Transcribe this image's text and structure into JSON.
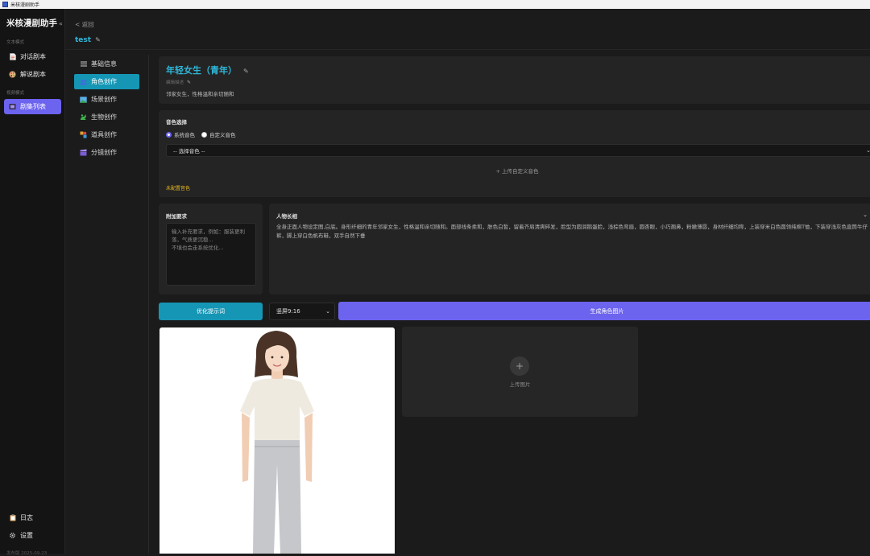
{
  "window": {
    "title": "米核漫剧助手"
  },
  "sidebar": {
    "brand": "米核漫剧助手",
    "collapse_glyph": "«",
    "section_text": "文本模式",
    "section_video": "视频模式",
    "items": [
      {
        "label": "对话剧本",
        "icon": "document-icon"
      },
      {
        "label": "解说剧本",
        "icon": "palette-icon"
      },
      {
        "label": "剧集列表",
        "icon": "film-icon",
        "active": true
      }
    ],
    "bottom": [
      {
        "label": "日志",
        "icon": "clipboard-icon"
      },
      {
        "label": "设置",
        "icon": "gear-icon"
      }
    ],
    "version": "发布版 2025-09-23"
  },
  "header": {
    "back_label": "< 返回",
    "project_title": "test"
  },
  "subnav": {
    "items": [
      {
        "label": "基础信息",
        "icon": "menu-icon"
      },
      {
        "label": "角色创作",
        "icon": "people-icon",
        "active": true
      },
      {
        "label": "场景创作",
        "icon": "landscape-icon"
      },
      {
        "label": "生物创作",
        "icon": "creature-icon"
      },
      {
        "label": "道具创作",
        "icon": "props-icon"
      },
      {
        "label": "分镜创作",
        "icon": "clapper-icon"
      }
    ]
  },
  "character": {
    "name": "年轻女生（青年）",
    "sub_label": "编辑描述",
    "description": "邻家女生，性格温和亲切随和"
  },
  "voice": {
    "title": "音色选择",
    "option_system": "系统音色",
    "option_custom": "自定义音色",
    "selected": "system",
    "select_value": "-- 选择音色 --",
    "upload_label": "+ 上传自定义音色",
    "warning": "未配置音色"
  },
  "extra": {
    "title": "附加要求",
    "placeholder": "输入补充要求，例如：服装更利落，气质更沉稳...\n不填也会走系统优化..."
  },
  "looks": {
    "title": "人物长相",
    "text": "全身正面人物设定图,白底。身形纤细的青年邻家女生，性格温和亲切随和。面部线条柔和，肤色白皙，留着齐肩清爽碎发，脸型为圆润鹅蛋脸，浅棕色弯眉，圆杏眼，小巧翘鼻，粉嫩薄唇，身材纤细均称，上装穿米白色圆领纯棉T恤，下装穿浅灰色直筒牛仔裤，脚上穿白色帆布鞋，双手自然下垂"
  },
  "actions": {
    "optimize_label": "优化提示词",
    "ratio_value": "竖屏9:16",
    "generate_label": "生成角色图片"
  },
  "upload": {
    "plus": "+",
    "label": "上传图片"
  },
  "colors": {
    "accent_purple": "#6c63ef",
    "accent_cyan": "#1596b5",
    "title_cyan": "#2fb6d8",
    "warning": "#e8b923"
  }
}
